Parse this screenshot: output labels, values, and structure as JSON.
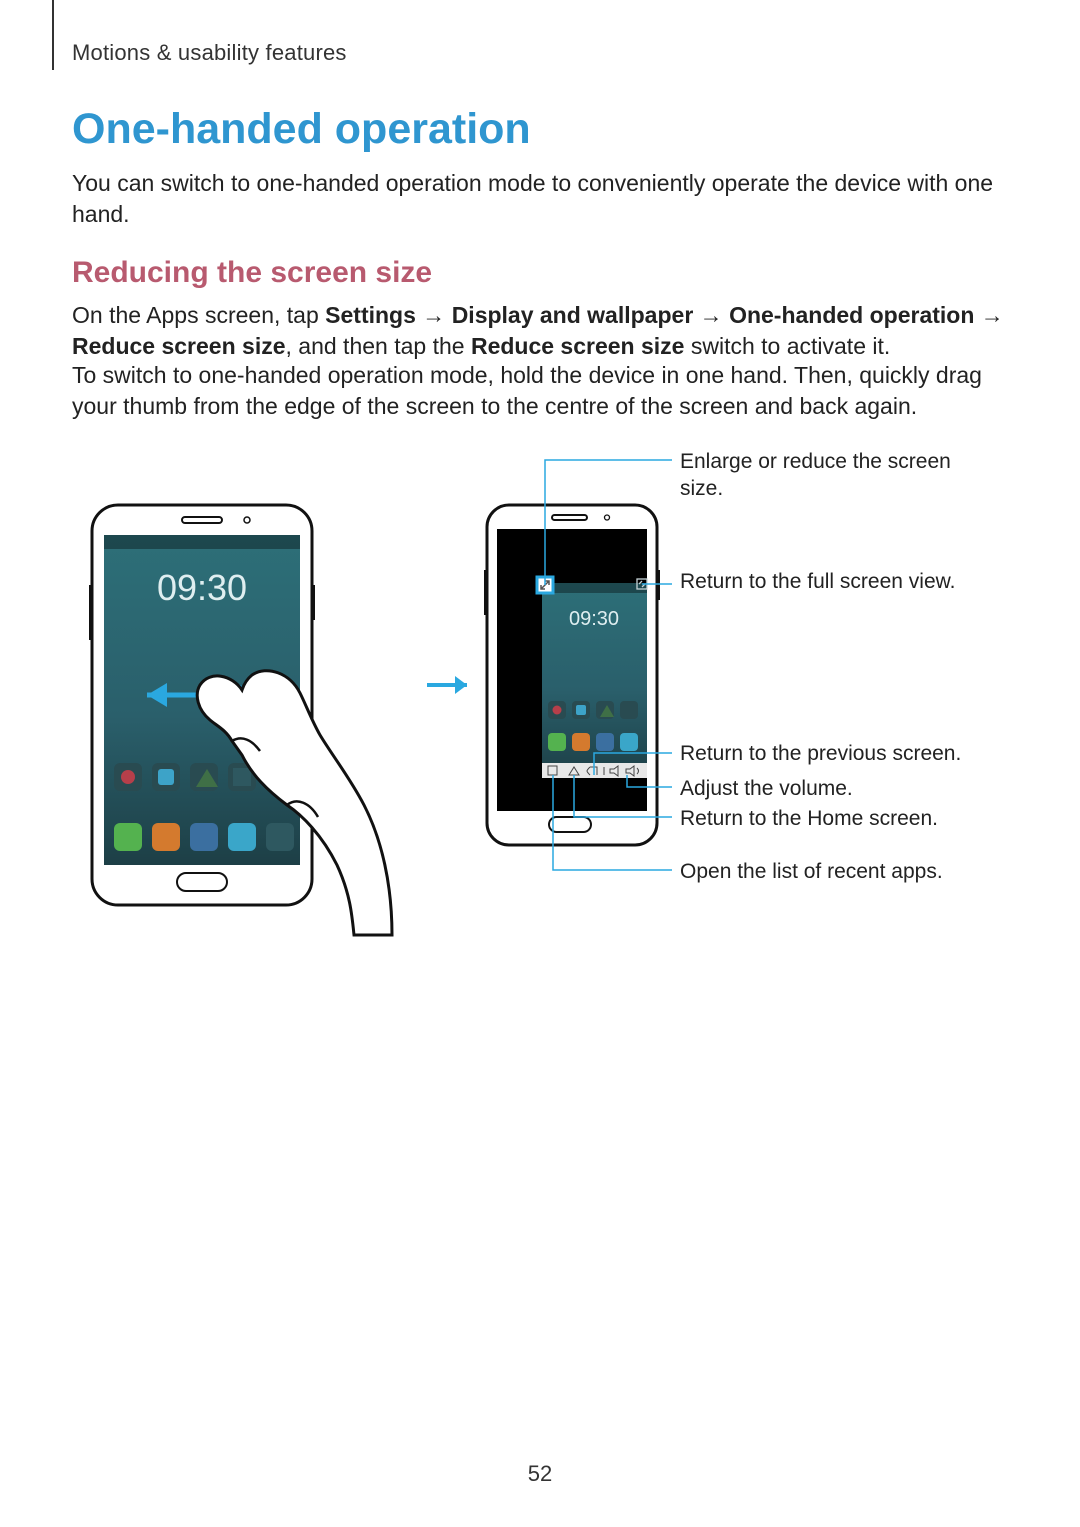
{
  "running_head": "Motions & usability features",
  "h1": "One-handed operation",
  "body1": "You can switch to one-handed operation mode to conveniently operate the device with one hand.",
  "h2": "Reducing the screen size",
  "body2": {
    "prefix": "On the Apps screen, tap ",
    "bold1": "Settings",
    "arrow": " → ",
    "bold2": "Display and wallpaper",
    "bold3": "One-handed operation",
    "bold4": "Reduce screen size",
    "mid": ", and then tap the ",
    "bold5": "Reduce screen size",
    "suffix": " switch to activate it."
  },
  "body3": "To switch to one-handed operation mode, hold the device in one hand. Then, quickly drag your thumb from the edge of the screen to the centre of the screen and back again.",
  "callouts": {
    "enlarge": "Enlarge or reduce the screen size.",
    "fullscreen": "Return to the full screen view.",
    "previous": "Return to the previous screen.",
    "volume": "Adjust the volume.",
    "home": "Return to the Home screen.",
    "recent": "Open the list of recent apps."
  },
  "page_number": "52",
  "figure": {
    "left_phone_time": "09:30",
    "right_phone_time": "09:30"
  }
}
